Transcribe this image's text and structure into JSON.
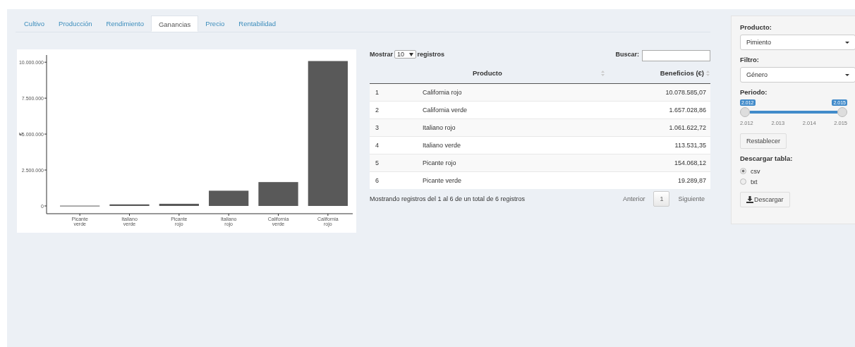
{
  "tabs": [
    {
      "label": "Cultivo",
      "selected": false
    },
    {
      "label": "Producción",
      "selected": false
    },
    {
      "label": "Rendimiento",
      "selected": false
    },
    {
      "label": "Ganancias",
      "selected": true
    },
    {
      "label": "Precio",
      "selected": false
    },
    {
      "label": "Rentabilidad",
      "selected": false
    }
  ],
  "chart": {
    "chart_data": {
      "type": "bar",
      "ylabel": "€",
      "categories": [
        "Picante verde",
        "Italiano verde",
        "Picante rojo",
        "Italiano rojo",
        "California verde",
        "California rojo"
      ],
      "values": [
        20000,
        110000,
        150000,
        1060000,
        1660000,
        10080000
      ],
      "ylim": [
        0,
        10500000
      ],
      "yticks": [
        {
          "value": 0,
          "label": "0"
        },
        {
          "value": 2500000,
          "label": "2.500.000"
        },
        {
          "value": 5000000,
          "label": "5.000.000"
        },
        {
          "value": 7500000,
          "label": "7.500.000"
        },
        {
          "value": 10000000,
          "label": "10.000.000"
        }
      ]
    }
  },
  "table": {
    "length_label_before": "Mostrar",
    "length_value": "10",
    "length_label_after": "registros",
    "search_label": "Buscar:",
    "columns": [
      "",
      "Producto",
      "Beneficios (€)"
    ],
    "rows": [
      [
        "1",
        "California rojo",
        "10.078.585,07"
      ],
      [
        "2",
        "California verde",
        "1.657.028,86"
      ],
      [
        "3",
        "Italiano rojo",
        "1.061.622,72"
      ],
      [
        "4",
        "Italiano verde",
        "113.531,35"
      ],
      [
        "5",
        "Picante rojo",
        "154.068,12"
      ],
      [
        "6",
        "Picante verde",
        "19.289,87"
      ]
    ],
    "info": "Mostrando registros del 1 al 6 de un total de 6 registros",
    "pagination": {
      "previous": "Anterior",
      "page": "1",
      "next": "Siguiente"
    }
  },
  "sidebar": {
    "product_label": "Producto:",
    "product_value": "Pimiento",
    "filter_label": "Filtro:",
    "filter_value": "Género",
    "period_label": "Periodo:",
    "period": {
      "from": "2.012",
      "to": "2.015",
      "level": 1,
      "ticks": [
        "2.012",
        "2.013",
        "2.014",
        "2.015"
      ]
    },
    "reset_button": "Restablecer",
    "download_label": "Descargar tabla:",
    "formats": [
      {
        "label": "csv",
        "selected": true
      },
      {
        "label": "txt",
        "selected": false
      }
    ],
    "download_button": "Descargar"
  }
}
